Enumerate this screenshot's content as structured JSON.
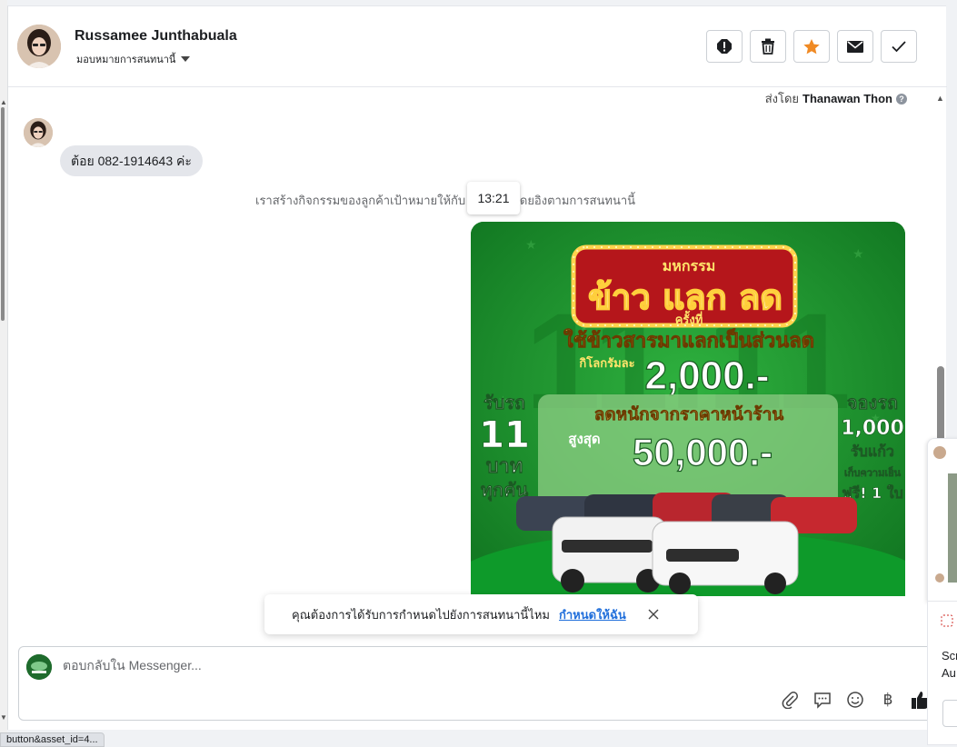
{
  "contact": {
    "name": "Russamee Junthabuala",
    "assign_label": "มอบหมายการสนทนานี้"
  },
  "actions": [
    "spam-icon",
    "delete-icon",
    "star-icon",
    "mail-icon",
    "done-icon"
  ],
  "thread": {
    "sent_by_prefix": "ส่งโดย",
    "sent_by_name": "Thanawan Thon",
    "incoming_message": "ต้อย 082-1914643 ค่ะ",
    "system_note": "เราสร้างกิจกรรมของลูกค้าเป้าหมายให้กับ                  อัตโนมัติโดยอิงตามการสนทนานี้",
    "timestamp": "13:21"
  },
  "promo": {
    "title_small": "มหกรรม",
    "title_big": "ข้าว แลก ลด",
    "round_label": "ครั้งที่",
    "headline": "ใช้ข้าวสารมาแลกเป็นส่วนลด",
    "per_kg": "กิโลกรัมละ",
    "per_kg_value": "2,000.-",
    "discount_line": "ลดหนักจากราคาหน้าร้าน",
    "max_label": "สูงสุด",
    "max_value": "50,000.-",
    "left_1": "รับรถ",
    "left_2": "11",
    "left_3": "บาท",
    "left_4": "ทุกคัน",
    "right_1": "จองรถ",
    "right_2": "1,000",
    "right_3": "รับแก้ว",
    "right_4": "เก็บความเย็น",
    "right_5": "ฟรี! 1 ใบ"
  },
  "toast": {
    "text": "คุณต้องการได้รับการกำหนดไปยังการสนทนานี้ไหม",
    "link": "กำหนดให้ฉัน"
  },
  "composer": {
    "placeholder": "ตอบกลับใน Messenger..."
  },
  "status_url": "button&asset_id=4...",
  "side_panel": {
    "line1": "Scr",
    "line2": "Au"
  },
  "colors": {
    "promo_green": "#1c8a2b",
    "star_orange": "#f08a24",
    "link_blue": "#216fdb"
  }
}
